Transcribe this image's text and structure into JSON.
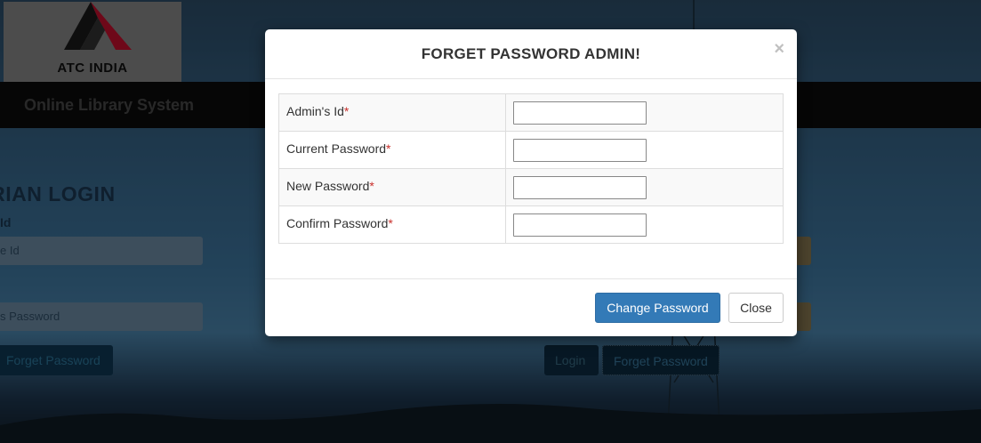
{
  "background": {
    "logo_text": "ATC INDIA",
    "brand": "Online Library System",
    "login_heading": "ARIAN LOGIN",
    "id_label": "Id",
    "id_placeholder": "e Id",
    "password_placeholder": "s Password",
    "forget_left_label": "Forget Password",
    "login_label": "Login",
    "forget_right_label": "Forget Password"
  },
  "modal": {
    "title": "FORGET PASSWORD ADMIN!",
    "close_symbol": "×",
    "fields": [
      {
        "label": "Admin's Id",
        "required": "*",
        "value": ""
      },
      {
        "label": "Current Password",
        "required": "*",
        "value": ""
      },
      {
        "label": "New Password",
        "required": "*",
        "value": ""
      },
      {
        "label": "Confirm Password",
        "required": "*",
        "value": ""
      }
    ],
    "change_password_label": "Change Password",
    "close_label": "Close"
  },
  "colors": {
    "primary": "#337ab7",
    "required": "#c9302c",
    "navbar": "#0c0c0c"
  }
}
